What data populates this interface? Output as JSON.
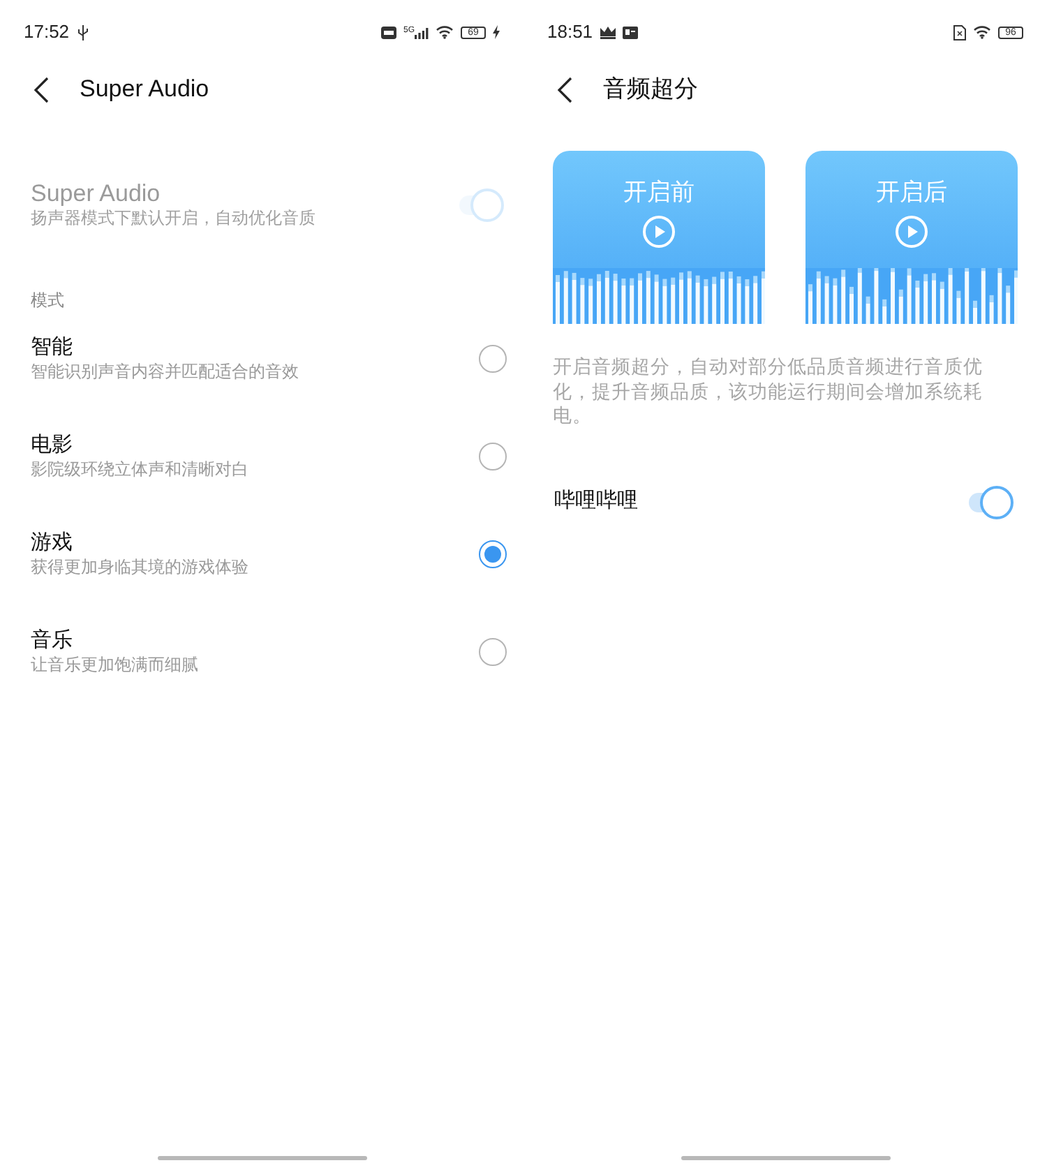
{
  "left_screen": {
    "status_bar": {
      "time": "17:52",
      "network": "5G",
      "battery": "69"
    },
    "title": "Super Audio",
    "master": {
      "title": "Super Audio",
      "subtitle": "扬声器模式下默认开启，自动优化音质",
      "on": true,
      "disabled": true
    },
    "section_label": "模式",
    "modes": [
      {
        "title": "智能",
        "subtitle": "智能识别声音内容并匹配适合的音效",
        "selected": false
      },
      {
        "title": "电影",
        "subtitle": "影院级环绕立体声和清晰对白",
        "selected": false
      },
      {
        "title": "游戏",
        "subtitle": "获得更加身临其境的游戏体验",
        "selected": true
      },
      {
        "title": "音乐",
        "subtitle": "让音乐更加饱满而细腻",
        "selected": false
      }
    ]
  },
  "right_screen": {
    "status_bar": {
      "time": "18:51",
      "battery": "96"
    },
    "title": "音频超分",
    "previews": [
      {
        "label": "开启前",
        "kind": "flat"
      },
      {
        "label": "开启后",
        "kind": "dynamic"
      }
    ],
    "description": "开启音频超分，自动对部分低品质音频进行音质优化，提升音频品质，该功能运行期间会增加系统耗电。",
    "toggles": [
      {
        "label": "哔哩哔哩",
        "on": true
      }
    ]
  }
}
